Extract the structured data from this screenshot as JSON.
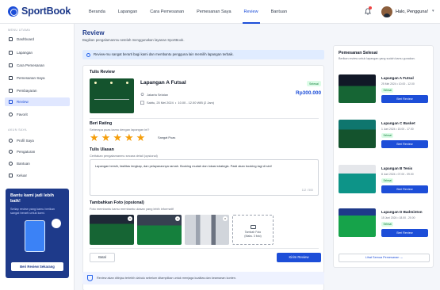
{
  "app": {
    "name": "SportBook"
  },
  "nav": [
    "Beranda",
    "Lapangan",
    "Cara Pemesanan",
    "Pemesanan Saya",
    "Review",
    "Bantuan"
  ],
  "user": {
    "greeting": "Halo, Pengguna!"
  },
  "sidebar": {
    "menu_title": "MENU UTAMA",
    "items": [
      "Dashboard",
      "Lapangan",
      "Cara Pemesanan",
      "Pemesanan Saya",
      "Pembayaran",
      "Review",
      "Favorit"
    ],
    "account_title": "AKUN SAYA",
    "account_items": [
      "Profil Saya",
      "Pengaturan",
      "Bantuan",
      "Keluar"
    ],
    "promo": {
      "title": "Bantu kami jadi lebih baik!",
      "subtitle": "Setiap review yang kamu berikan sangat berarti untuk kami.",
      "button": "Beri Review Sekarang"
    }
  },
  "page": {
    "title": "Review",
    "subtitle": "Bagikan pengalamanmu setelah menggunakan layanan SportBook.",
    "banner": "Review-mu sangat berarti bagi kami dan membantu pengguna lain memilih lapangan terbaik."
  },
  "form": {
    "section_title": "Tulis Review",
    "field": {
      "name": "Lapangan A Futsal",
      "location": "Jakarta Selatan",
      "date": "Sabtu, 25 Mei 2024",
      "time": "10.00 - 12.00 WIB (2 Jam)",
      "status": "Selesai",
      "price": "Rp300.000"
    },
    "rating_title": "Beri Rating",
    "rating_sub": "Seberapa puas kamu dengan lapangan ini?",
    "rating_value": 5,
    "rating_label": "Sangat Puas",
    "review_title": "Tulis Ulasan",
    "review_sub": "Ceritakan pengalamanmu secara detail (opsional)",
    "review_text": "Lapangan bersih, fasilitas lengkap, dan pelayanannya ramah. Booking mudah dan lokasi strategis. Pasti akan booking lagi di sini!",
    "counter": "112 / 500",
    "photo_title": "Tambahkan Foto (opsional)",
    "photo_sub": "Foto membantu kamu membantu ulasan yang lebih informatif",
    "add_photo": "Tambah Foto",
    "add_photo_hint": "(Maks. 3 foto)",
    "cancel": "Batal",
    "submit": "Kirim Review",
    "footer": "Review akan ditinjau terlebih dahulu sebelum ditampilkan untuk menjaga kualitas dan keamanan konten."
  },
  "completed": {
    "title": "Pemesanan Selesai",
    "subtitle": "Berikan review untuk lapangan yang sudah kamu gunakan.",
    "button": "Beri Review",
    "items": [
      {
        "name": "Lapangan A Futsal",
        "date": "25 Mei 2024",
        "time": "10.00 - 12.00",
        "status": "Selesai"
      },
      {
        "name": "Lapangan C Basket",
        "date": "1 Juni 2024",
        "time": "15.00 - 17.00",
        "status": "Selesai"
      },
      {
        "name": "Lapangan B Tenis",
        "date": "8 Juni 2024",
        "time": "07.00 - 09.00",
        "status": "Selesai"
      },
      {
        "name": "Lapangan D Badminton",
        "date": "15 Juni 2024",
        "time": "18.00 - 20.00",
        "status": "Selesai"
      }
    ],
    "all_link": "Lihat Semua Pemesanan"
  },
  "colors": {
    "primary": "#1d4ed8",
    "dark": "#1e3a8a",
    "success": "#15803d",
    "star": "#f59e0b"
  }
}
